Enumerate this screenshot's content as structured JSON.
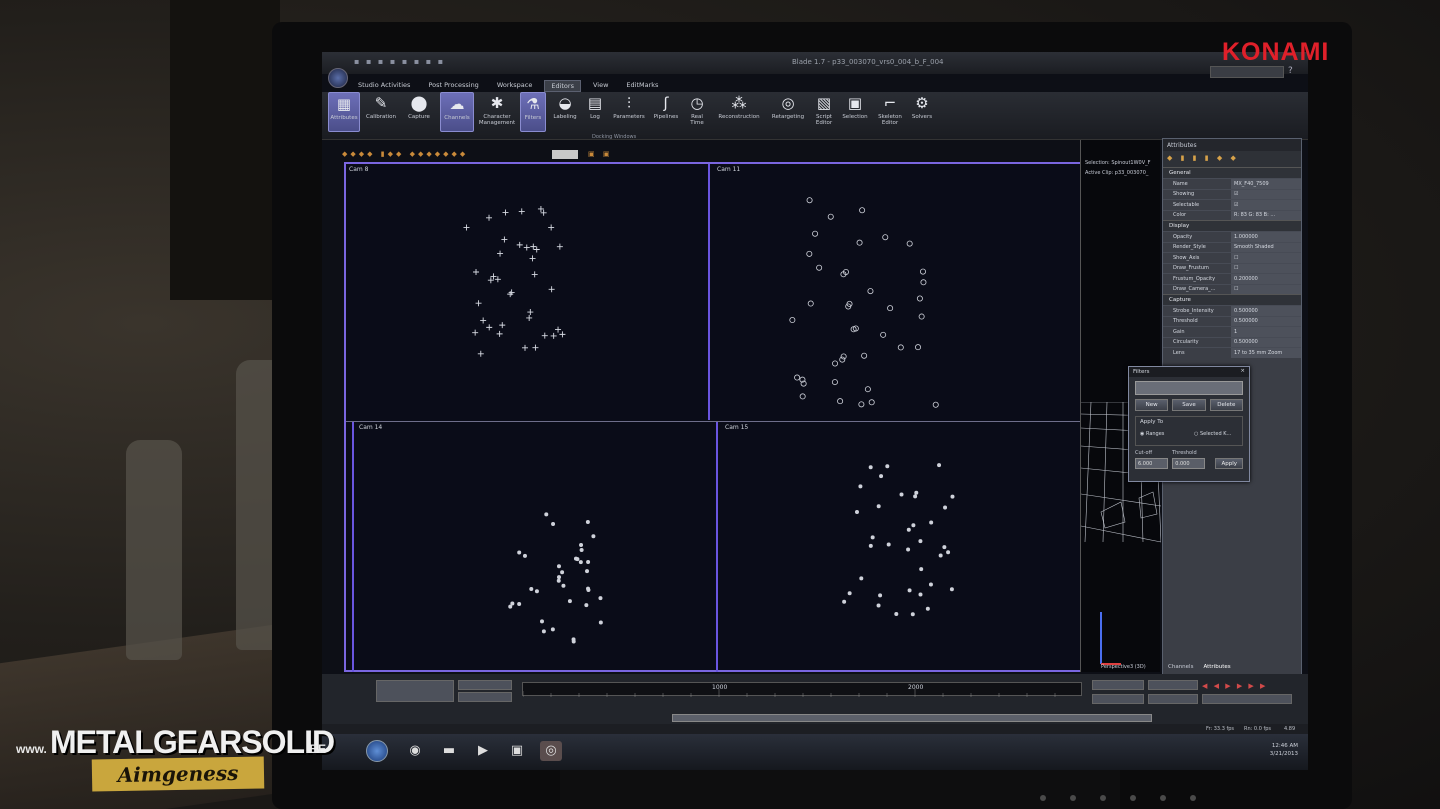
{
  "window": {
    "title": "Blade 1.7 - p33_003070_vrs0_004_b_F_004",
    "qat_icons": "▪ ▪ ▪ ▪ ▪ ▪ ▪ ▪"
  },
  "watermarks": {
    "konami": "KONAMI",
    "site_prefix": "www.",
    "site_name": "METALGEARSOLID",
    "site_suffix": ".BE",
    "site_tagline": "Aimgeness"
  },
  "menu": [
    {
      "label": "Studio Activities",
      "active": false
    },
    {
      "label": "Post Processing",
      "active": false
    },
    {
      "label": "Workspace",
      "active": false
    },
    {
      "label": "Editors",
      "active": true
    },
    {
      "label": "View",
      "active": false
    },
    {
      "label": "EditMarks",
      "active": false
    }
  ],
  "ribbon": {
    "group_label": "Docking Windows",
    "buttons": [
      {
        "label": "Attributes",
        "icon": "attributes-icon",
        "glyph": "▦",
        "active": true
      },
      {
        "label": "Calibration",
        "icon": "calibration-icon",
        "glyph": "✎",
        "active": false
      },
      {
        "label": "Capture",
        "icon": "capture-icon",
        "glyph": "⬤",
        "active": false
      },
      {
        "label": "Channels",
        "icon": "channels-icon",
        "glyph": "☁",
        "active": true
      },
      {
        "label": "Character Management",
        "icon": "character-icon",
        "glyph": "✱",
        "active": false
      },
      {
        "label": "Filters",
        "icon": "filters-icon",
        "glyph": "⚗",
        "active": true
      },
      {
        "label": "Labeling",
        "icon": "labeling-icon",
        "glyph": "◒",
        "active": false
      },
      {
        "label": "Log",
        "icon": "log-icon",
        "glyph": "▤",
        "active": false
      },
      {
        "label": "Parameters",
        "icon": "parameters-icon",
        "glyph": "⫶",
        "active": false
      },
      {
        "label": "Pipelines",
        "icon": "pipelines-icon",
        "glyph": "ʃ",
        "active": false
      },
      {
        "label": "Real Time",
        "icon": "realtime-icon",
        "glyph": "◷",
        "active": false
      },
      {
        "label": "Reconstruction",
        "icon": "reconstruction-icon",
        "glyph": "⁂",
        "active": false
      },
      {
        "label": "Retargeting",
        "icon": "retargeting-icon",
        "glyph": "◎",
        "active": false
      },
      {
        "label": "Script Editor",
        "icon": "script-icon",
        "glyph": "▧",
        "active": false
      },
      {
        "label": "Selection",
        "icon": "selection-icon",
        "glyph": "▣",
        "active": false
      },
      {
        "label": "Skeleton Editor",
        "icon": "skeleton-icon",
        "glyph": "⌐",
        "active": false
      },
      {
        "label": "Solvers",
        "icon": "solvers-icon",
        "glyph": "⚙",
        "active": false
      }
    ]
  },
  "viewport_toolbar": {
    "icons": "◆◆◆◆ ▮◆◆ ◆◆◆◆◆◆◆",
    "right_icons": "▣ ▣"
  },
  "viewports": [
    {
      "label": "Cam 8"
    },
    {
      "label": "Cam 11"
    },
    {
      "label": "Cam 14"
    },
    {
      "label": "Cam 15"
    }
  ],
  "side_viewport": {
    "selection": "Selection: Spinout1W0V_F",
    "active_clip": "Active Clip: p33_003070_",
    "bottom_label": "Perspective3 (3D)"
  },
  "attributes": {
    "title": "Attributes",
    "tool_icons": "◆ ▮ ▮ ▮ ◆ ◆",
    "sections": [
      {
        "name": "General",
        "rows": [
          {
            "key": "Name",
            "value": "MX_F40_7509"
          },
          {
            "key": "Showing",
            "value": "☑"
          },
          {
            "key": "Selectable",
            "value": "☑"
          },
          {
            "key": "Color",
            "value": "R: 83 G: 83 B: ..."
          }
        ]
      },
      {
        "name": "Display",
        "rows": [
          {
            "key": "Opacity",
            "value": "1.000000"
          },
          {
            "key": "Render_Style",
            "value": "Smooth Shaded"
          },
          {
            "key": "Show_Axis",
            "value": "☐"
          },
          {
            "key": "Draw_Frustum",
            "value": "☐"
          },
          {
            "key": "Frustum_Opacity",
            "value": "0.200000"
          },
          {
            "key": "Draw_Camera_...",
            "value": "☐"
          }
        ]
      },
      {
        "name": "Capture",
        "rows": [
          {
            "key": "Strobe_Intensity",
            "value": "0.500000"
          },
          {
            "key": "Threshold",
            "value": "0.500000"
          },
          {
            "key": "Gain",
            "value": "1"
          },
          {
            "key": "Circularity",
            "value": "0.500000"
          },
          {
            "key": "Lens",
            "value": "17 to 35 mm Zoom"
          }
        ]
      }
    ],
    "tabs": [
      {
        "label": "Channels",
        "active": false
      },
      {
        "label": "Attributes",
        "active": true
      }
    ]
  },
  "filters_dialog": {
    "title": "Filters",
    "close": "×",
    "buttons": [
      "New",
      "Save",
      "Delete"
    ],
    "apply_to_label": "Apply To",
    "radio_ranges": "◉ Ranges",
    "radio_selected": "○ Selected K...",
    "cutoff_label": "Cut-off",
    "threshold_label": "Threshold",
    "cutoff_value": "6.000",
    "threshold_value": "0.000",
    "apply_button": "Apply"
  },
  "timeline": {
    "ticks": [
      "1000",
      "2000"
    ],
    "transport_icons": "◀ ◀ ▶ ▶ ▶ ▶"
  },
  "status": {
    "fps1": "Fr: 33.3 fps",
    "fps2": "Rn: 0.0 fps",
    "counter": "4.89"
  },
  "taskbar": {
    "time": "12:46 AM",
    "date": "3/21/2013",
    "apps": [
      {
        "icon": "firefox-icon",
        "glyph": "◉"
      },
      {
        "icon": "folder-icon",
        "glyph": "▬"
      },
      {
        "icon": "media-icon",
        "glyph": "▶"
      },
      {
        "icon": "app-icon",
        "glyph": "▣"
      },
      {
        "icon": "blade-icon",
        "glyph": "◎"
      }
    ]
  }
}
